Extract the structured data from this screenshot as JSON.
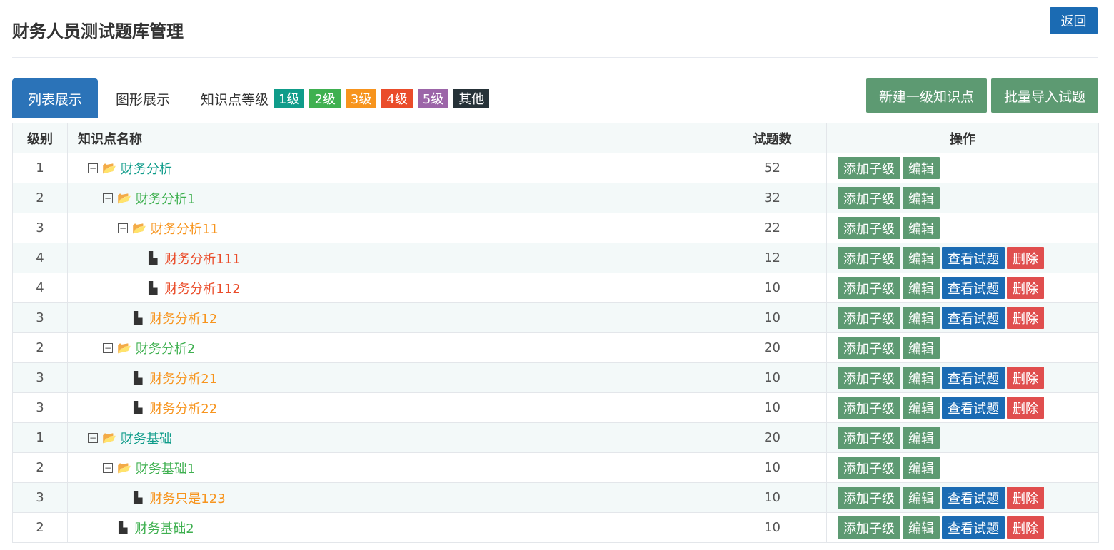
{
  "header": {
    "title": "财务人员测试题库管理",
    "back_label": "返回"
  },
  "tabs": [
    {
      "label": "列表展示",
      "active": true
    },
    {
      "label": "图形展示",
      "active": false
    }
  ],
  "levels": {
    "label": "知识点等级",
    "items": [
      {
        "label": "1级",
        "color": "#0f9c8a"
      },
      {
        "label": "2级",
        "color": "#3fb050"
      },
      {
        "label": "3级",
        "color": "#f7941d"
      },
      {
        "label": "4级",
        "color": "#ea4c2a"
      },
      {
        "label": "5级",
        "color": "#9c65a8"
      },
      {
        "label": "其他",
        "color": "#263238"
      }
    ]
  },
  "actions": {
    "new_label": "新建一级知识点",
    "import_label": "批量导入试题"
  },
  "table": {
    "columns": [
      "级别",
      "知识点名称",
      "试题数",
      "操作"
    ],
    "op_labels": {
      "add": "添加子级",
      "edit": "编辑",
      "view": "查看试题",
      "delete": "删除"
    },
    "rows": [
      {
        "level": "1",
        "name": "财务分析",
        "count": "52",
        "type": "folder"
      },
      {
        "level": "2",
        "name": "财务分析1",
        "count": "32",
        "type": "folder"
      },
      {
        "level": "3",
        "name": "财务分析11",
        "count": "22",
        "type": "folder"
      },
      {
        "level": "4",
        "name": "财务分析111",
        "count": "12",
        "type": "file"
      },
      {
        "level": "4",
        "name": "财务分析112",
        "count": "10",
        "type": "file"
      },
      {
        "level": "3",
        "name": "财务分析12",
        "count": "10",
        "type": "file"
      },
      {
        "level": "2",
        "name": "财务分析2",
        "count": "20",
        "type": "folder"
      },
      {
        "level": "3",
        "name": "财务分析21",
        "count": "10",
        "type": "file"
      },
      {
        "level": "3",
        "name": "财务分析22",
        "count": "10",
        "type": "file"
      },
      {
        "level": "1",
        "name": "财务基础",
        "count": "20",
        "type": "folder"
      },
      {
        "level": "2",
        "name": "财务基础1",
        "count": "10",
        "type": "folder"
      },
      {
        "level": "3",
        "name": "财务只是123",
        "count": "10",
        "type": "file"
      },
      {
        "level": "2",
        "name": "财务基础2",
        "count": "10",
        "type": "file"
      }
    ]
  }
}
